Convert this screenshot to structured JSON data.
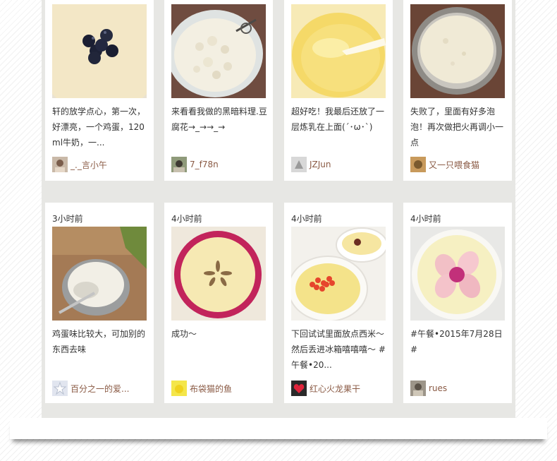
{
  "feed": {
    "row1": [
      {
        "description": "轩的放学点心，第一次，好漂亮，一个鸡蛋，120ml牛奶，一...",
        "user": "_._言小午"
      },
      {
        "description": "来看看我做的黑暗料理.豆腐花→_→→_→",
        "user": "7_f78n"
      },
      {
        "description": "超好吃！我最后还放了一层炼乳在上面(´･ω･`)",
        "user": "JZJun"
      },
      {
        "description": "失败了，里面有好多泡泡！再次做把火再调小一点",
        "user": "又一只喂食猫"
      }
    ],
    "row2": [
      {
        "time": "3小时前",
        "description": "鸡蛋味比较大，可加别的东西去味",
        "user": "百分之一的爱..."
      },
      {
        "time": "4小时前",
        "description": "成功～",
        "user": "布袋猫的鱼"
      },
      {
        "time": "4小时前",
        "description": "下回试试里面放点西米～然后丢进冰箱嘻嘻嘻～ #午餐•20...",
        "user": "红心火龙果干"
      },
      {
        "time": "4小时前",
        "description": "#午餐•2015年7月28日#",
        "user": "rues"
      }
    ]
  },
  "colors": {
    "panel_bg": "#e7e7e4",
    "card_bg": "#ffffff",
    "username": "#8a5a44",
    "text": "#333333"
  }
}
